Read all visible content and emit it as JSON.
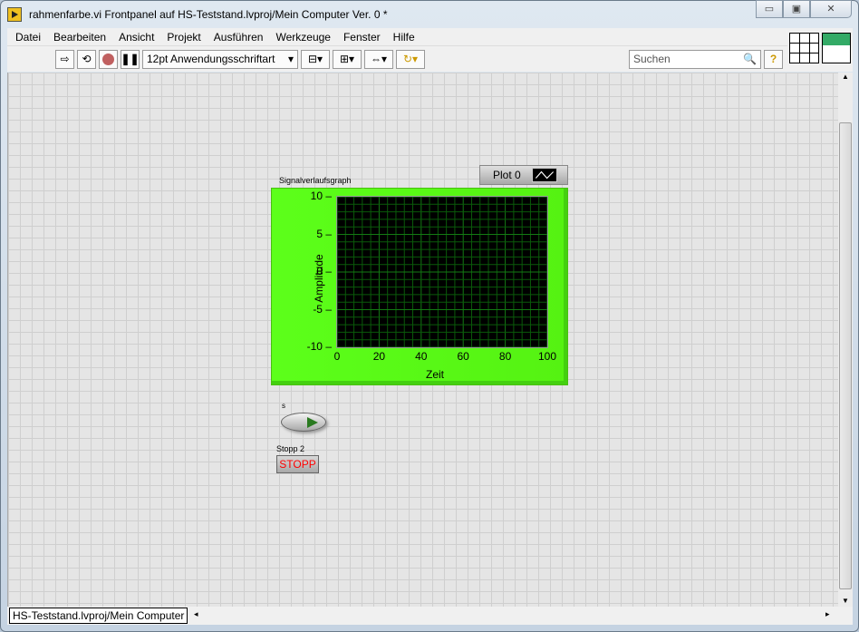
{
  "window": {
    "title": "rahmenfarbe.vi Frontpanel auf HS-Teststand.lvproj/Mein Computer Ver. 0 *",
    "minimize": "▭",
    "maximize": "▣",
    "close": "✕"
  },
  "menu": [
    "Datei",
    "Bearbeiten",
    "Ansicht",
    "Projekt",
    "Ausführen",
    "Werkzeuge",
    "Fenster",
    "Hilfe"
  ],
  "toolbar": {
    "font": "12pt Anwendungsschriftart",
    "search_placeholder": "Suchen",
    "help": "?"
  },
  "graph": {
    "label": "Signalverlaufsgraph",
    "legend": "Plot 0",
    "plot_bg": "#000000",
    "frame_color": "#5cff1a",
    "grid_color": "#0a5a0a"
  },
  "chart_data": {
    "type": "line",
    "title": "Signalverlaufsgraph",
    "xlabel": "Zeit",
    "ylabel": "Amplitude",
    "xlim": [
      0,
      100
    ],
    "ylim": [
      -10,
      10
    ],
    "xticks": [
      "0",
      "20",
      "40",
      "60",
      "80",
      "100"
    ],
    "yticks": [
      "10",
      "5",
      "0",
      "-5",
      "-10"
    ],
    "legend": [
      "Plot 0"
    ],
    "legend_placement": "top-right",
    "grid": true,
    "series": [
      {
        "name": "Plot 0",
        "values": []
      }
    ]
  },
  "controls": {
    "toggle_label": "s",
    "stop_label": "Stopp 2",
    "stop_text": "STOPP"
  },
  "status": {
    "path": "HS-Teststand.lvproj/Mein Computer"
  }
}
